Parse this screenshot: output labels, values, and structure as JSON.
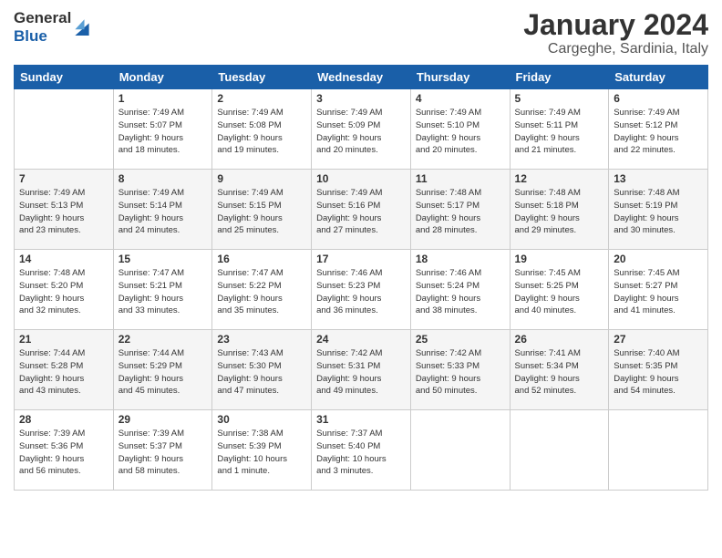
{
  "logo": {
    "general": "General",
    "blue": "Blue"
  },
  "title": {
    "month_year": "January 2024",
    "location": "Cargeghe, Sardinia, Italy"
  },
  "headers": [
    "Sunday",
    "Monday",
    "Tuesday",
    "Wednesday",
    "Thursday",
    "Friday",
    "Saturday"
  ],
  "weeks": [
    [
      {
        "day": "",
        "info": ""
      },
      {
        "day": "1",
        "info": "Sunrise: 7:49 AM\nSunset: 5:07 PM\nDaylight: 9 hours\nand 18 minutes."
      },
      {
        "day": "2",
        "info": "Sunrise: 7:49 AM\nSunset: 5:08 PM\nDaylight: 9 hours\nand 19 minutes."
      },
      {
        "day": "3",
        "info": "Sunrise: 7:49 AM\nSunset: 5:09 PM\nDaylight: 9 hours\nand 20 minutes."
      },
      {
        "day": "4",
        "info": "Sunrise: 7:49 AM\nSunset: 5:10 PM\nDaylight: 9 hours\nand 20 minutes."
      },
      {
        "day": "5",
        "info": "Sunrise: 7:49 AM\nSunset: 5:11 PM\nDaylight: 9 hours\nand 21 minutes."
      },
      {
        "day": "6",
        "info": "Sunrise: 7:49 AM\nSunset: 5:12 PM\nDaylight: 9 hours\nand 22 minutes."
      }
    ],
    [
      {
        "day": "7",
        "info": "Sunrise: 7:49 AM\nSunset: 5:13 PM\nDaylight: 9 hours\nand 23 minutes."
      },
      {
        "day": "8",
        "info": "Sunrise: 7:49 AM\nSunset: 5:14 PM\nDaylight: 9 hours\nand 24 minutes."
      },
      {
        "day": "9",
        "info": "Sunrise: 7:49 AM\nSunset: 5:15 PM\nDaylight: 9 hours\nand 25 minutes."
      },
      {
        "day": "10",
        "info": "Sunrise: 7:49 AM\nSunset: 5:16 PM\nDaylight: 9 hours\nand 27 minutes."
      },
      {
        "day": "11",
        "info": "Sunrise: 7:48 AM\nSunset: 5:17 PM\nDaylight: 9 hours\nand 28 minutes."
      },
      {
        "day": "12",
        "info": "Sunrise: 7:48 AM\nSunset: 5:18 PM\nDaylight: 9 hours\nand 29 minutes."
      },
      {
        "day": "13",
        "info": "Sunrise: 7:48 AM\nSunset: 5:19 PM\nDaylight: 9 hours\nand 30 minutes."
      }
    ],
    [
      {
        "day": "14",
        "info": "Sunrise: 7:48 AM\nSunset: 5:20 PM\nDaylight: 9 hours\nand 32 minutes."
      },
      {
        "day": "15",
        "info": "Sunrise: 7:47 AM\nSunset: 5:21 PM\nDaylight: 9 hours\nand 33 minutes."
      },
      {
        "day": "16",
        "info": "Sunrise: 7:47 AM\nSunset: 5:22 PM\nDaylight: 9 hours\nand 35 minutes."
      },
      {
        "day": "17",
        "info": "Sunrise: 7:46 AM\nSunset: 5:23 PM\nDaylight: 9 hours\nand 36 minutes."
      },
      {
        "day": "18",
        "info": "Sunrise: 7:46 AM\nSunset: 5:24 PM\nDaylight: 9 hours\nand 38 minutes."
      },
      {
        "day": "19",
        "info": "Sunrise: 7:45 AM\nSunset: 5:25 PM\nDaylight: 9 hours\nand 40 minutes."
      },
      {
        "day": "20",
        "info": "Sunrise: 7:45 AM\nSunset: 5:27 PM\nDaylight: 9 hours\nand 41 minutes."
      }
    ],
    [
      {
        "day": "21",
        "info": "Sunrise: 7:44 AM\nSunset: 5:28 PM\nDaylight: 9 hours\nand 43 minutes."
      },
      {
        "day": "22",
        "info": "Sunrise: 7:44 AM\nSunset: 5:29 PM\nDaylight: 9 hours\nand 45 minutes."
      },
      {
        "day": "23",
        "info": "Sunrise: 7:43 AM\nSunset: 5:30 PM\nDaylight: 9 hours\nand 47 minutes."
      },
      {
        "day": "24",
        "info": "Sunrise: 7:42 AM\nSunset: 5:31 PM\nDaylight: 9 hours\nand 49 minutes."
      },
      {
        "day": "25",
        "info": "Sunrise: 7:42 AM\nSunset: 5:33 PM\nDaylight: 9 hours\nand 50 minutes."
      },
      {
        "day": "26",
        "info": "Sunrise: 7:41 AM\nSunset: 5:34 PM\nDaylight: 9 hours\nand 52 minutes."
      },
      {
        "day": "27",
        "info": "Sunrise: 7:40 AM\nSunset: 5:35 PM\nDaylight: 9 hours\nand 54 minutes."
      }
    ],
    [
      {
        "day": "28",
        "info": "Sunrise: 7:39 AM\nSunset: 5:36 PM\nDaylight: 9 hours\nand 56 minutes."
      },
      {
        "day": "29",
        "info": "Sunrise: 7:39 AM\nSunset: 5:37 PM\nDaylight: 9 hours\nand 58 minutes."
      },
      {
        "day": "30",
        "info": "Sunrise: 7:38 AM\nSunset: 5:39 PM\nDaylight: 10 hours\nand 1 minute."
      },
      {
        "day": "31",
        "info": "Sunrise: 7:37 AM\nSunset: 5:40 PM\nDaylight: 10 hours\nand 3 minutes."
      },
      {
        "day": "",
        "info": ""
      },
      {
        "day": "",
        "info": ""
      },
      {
        "day": "",
        "info": ""
      }
    ]
  ]
}
